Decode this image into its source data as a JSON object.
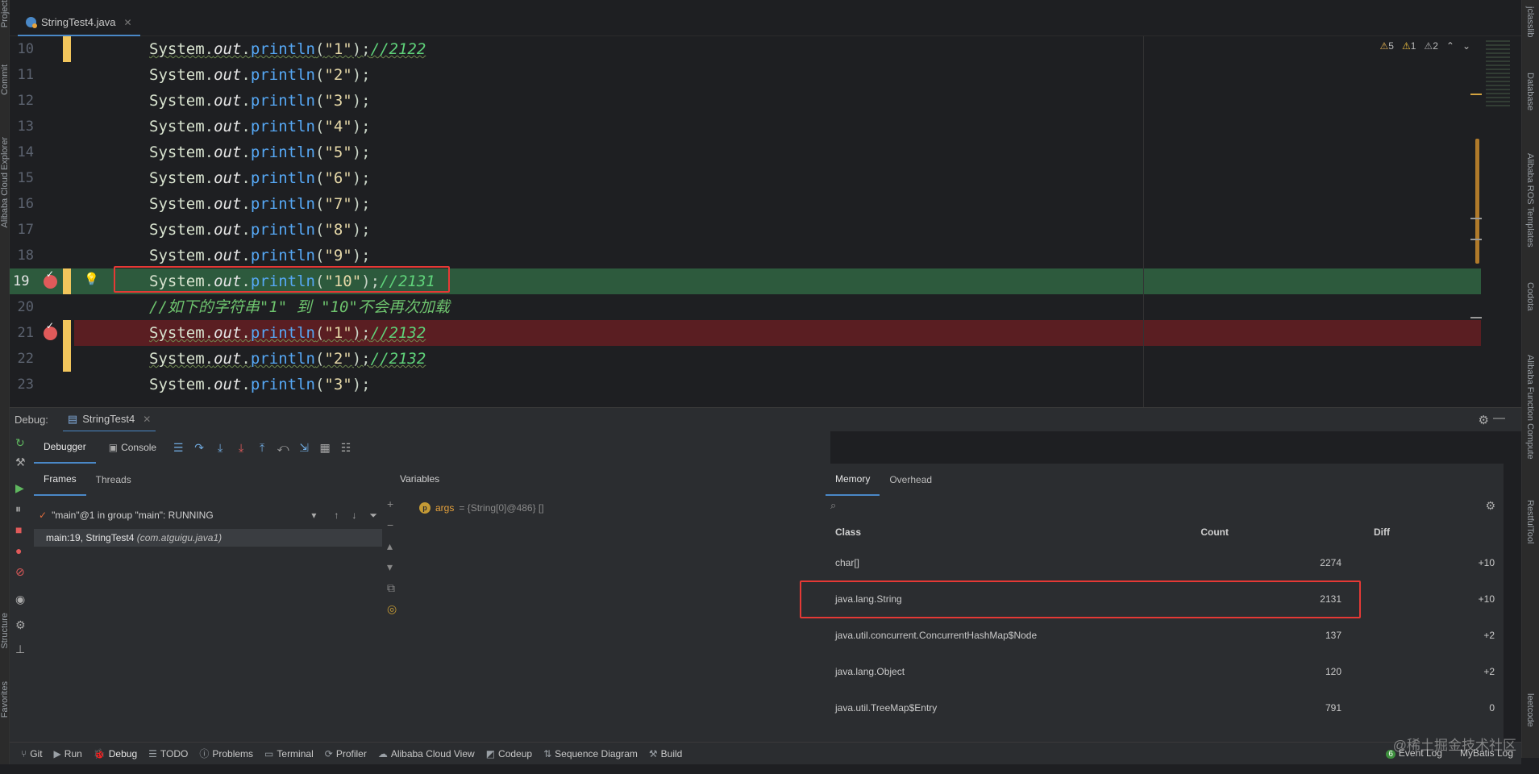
{
  "editor": {
    "tab_title": "StringTest4.java",
    "warnings": {
      "w1": "5",
      "w2": "1",
      "w3": "2"
    },
    "lines": [
      {
        "num": "10",
        "cls": "System",
        "field": "out",
        "method": "println",
        "arg": "\"1\"",
        "comment": "//2122"
      },
      {
        "num": "11",
        "cls": "System",
        "field": "out",
        "method": "println",
        "arg": "\"2\"",
        "comment": ""
      },
      {
        "num": "12",
        "cls": "System",
        "field": "out",
        "method": "println",
        "arg": "\"3\"",
        "comment": ""
      },
      {
        "num": "13",
        "cls": "System",
        "field": "out",
        "method": "println",
        "arg": "\"4\"",
        "comment": ""
      },
      {
        "num": "14",
        "cls": "System",
        "field": "out",
        "method": "println",
        "arg": "\"5\"",
        "comment": ""
      },
      {
        "num": "15",
        "cls": "System",
        "field": "out",
        "method": "println",
        "arg": "\"6\"",
        "comment": ""
      },
      {
        "num": "16",
        "cls": "System",
        "field": "out",
        "method": "println",
        "arg": "\"7\"",
        "comment": ""
      },
      {
        "num": "17",
        "cls": "System",
        "field": "out",
        "method": "println",
        "arg": "\"8\"",
        "comment": ""
      },
      {
        "num": "18",
        "cls": "System",
        "field": "out",
        "method": "println",
        "arg": "\"9\"",
        "comment": ""
      },
      {
        "num": "19",
        "cls": "System",
        "field": "out",
        "method": "println",
        "arg": "\"10\"",
        "comment": "//2131"
      },
      {
        "num": "20",
        "full_comment": "//如下的字符串\"1\" 到 \"10\"不会再次加载"
      },
      {
        "num": "21",
        "cls": "System",
        "field": "out",
        "method": "println",
        "arg": "\"1\"",
        "comment": "//2132"
      },
      {
        "num": "22",
        "cls": "System",
        "field": "out",
        "method": "println",
        "arg": "\"2\"",
        "comment": "//2132"
      },
      {
        "num": "23",
        "cls": "System",
        "field": "out",
        "method": "println",
        "arg": "\"3\"",
        "comment": ""
      }
    ]
  },
  "debug": {
    "label": "Debug:",
    "session_tab": "StringTest4",
    "tabs": {
      "debugger": "Debugger",
      "console": "Console"
    },
    "frames_tabs": {
      "frames": "Frames",
      "threads": "Threads"
    },
    "thread_text": "\"main\"@1 in group \"main\": RUNNING",
    "selected_frame": "main:19, StringTest4",
    "selected_frame_pkg": "(com.atguigu.java1)",
    "variables_title": "Variables",
    "var_name": "args",
    "var_value": "= {String[0]@486} []"
  },
  "memory": {
    "tabs": {
      "memory": "Memory",
      "overhead": "Overhead"
    },
    "headers": {
      "class": "Class",
      "count": "Count",
      "diff": "Diff"
    },
    "rows": [
      {
        "class": "char[]",
        "count": "2274",
        "diff": "+10"
      },
      {
        "class": "java.lang.String",
        "count": "2131",
        "diff": "+10"
      },
      {
        "class": "java.util.concurrent.ConcurrentHashMap$Node",
        "count": "137",
        "diff": "+2"
      },
      {
        "class": "java.lang.Object",
        "count": "120",
        "diff": "+2"
      },
      {
        "class": "java.util.TreeMap$Entry",
        "count": "791",
        "diff": "0"
      }
    ]
  },
  "bottom_bar": {
    "items": [
      "Git",
      "Run",
      "Debug",
      "TODO",
      "Problems",
      "Terminal",
      "Profiler",
      "Alibaba Cloud View",
      "Codeup",
      "Sequence Diagram",
      "Build"
    ],
    "right": [
      "Event Log",
      "MyBatis Log"
    ],
    "event_count": "6"
  },
  "right_strip": [
    "jclasslib",
    "Database",
    "Alibaba ROS Templates",
    "Codota",
    "Alibaba Function Compute",
    "RestfulTool",
    "leetcode"
  ],
  "left_strip": [
    "Project",
    "Commit",
    "Alibaba Cloud Explorer",
    "Structure",
    "Favorites"
  ],
  "watermark": "@稀土掘金技术社区",
  "colors": {
    "accent": "#4a88c7",
    "breakpoint": "#e05a5a",
    "callout": "#e53935",
    "current_line": "#2d5a3d",
    "breakpoint_line": "#5a1e22"
  }
}
